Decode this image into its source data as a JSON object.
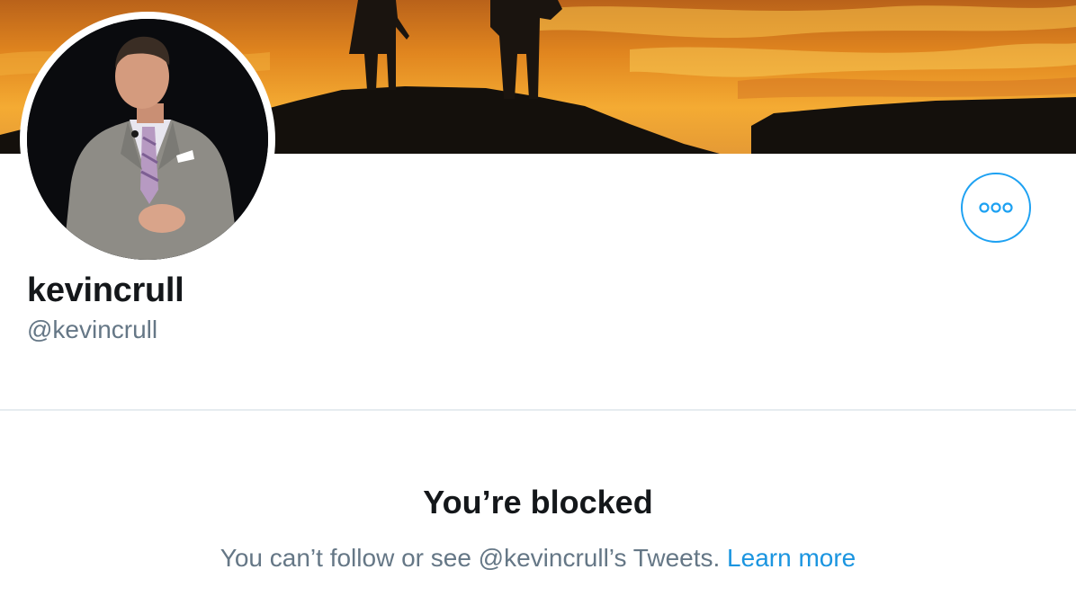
{
  "profile": {
    "display_name": "kevincrull",
    "handle": "@kevincrull"
  },
  "blocked": {
    "title": "You’re blocked",
    "message": "You can’t follow or see @kevincrull’s Tweets.",
    "learn_more_label": "Learn more"
  },
  "icons": {
    "more": "more-horizontal-icon"
  },
  "colors": {
    "accent": "#1da1f2",
    "link": "#1b95e0",
    "text_primary": "#14171a",
    "text_secondary": "#657786",
    "divider": "#e6ecf0"
  }
}
